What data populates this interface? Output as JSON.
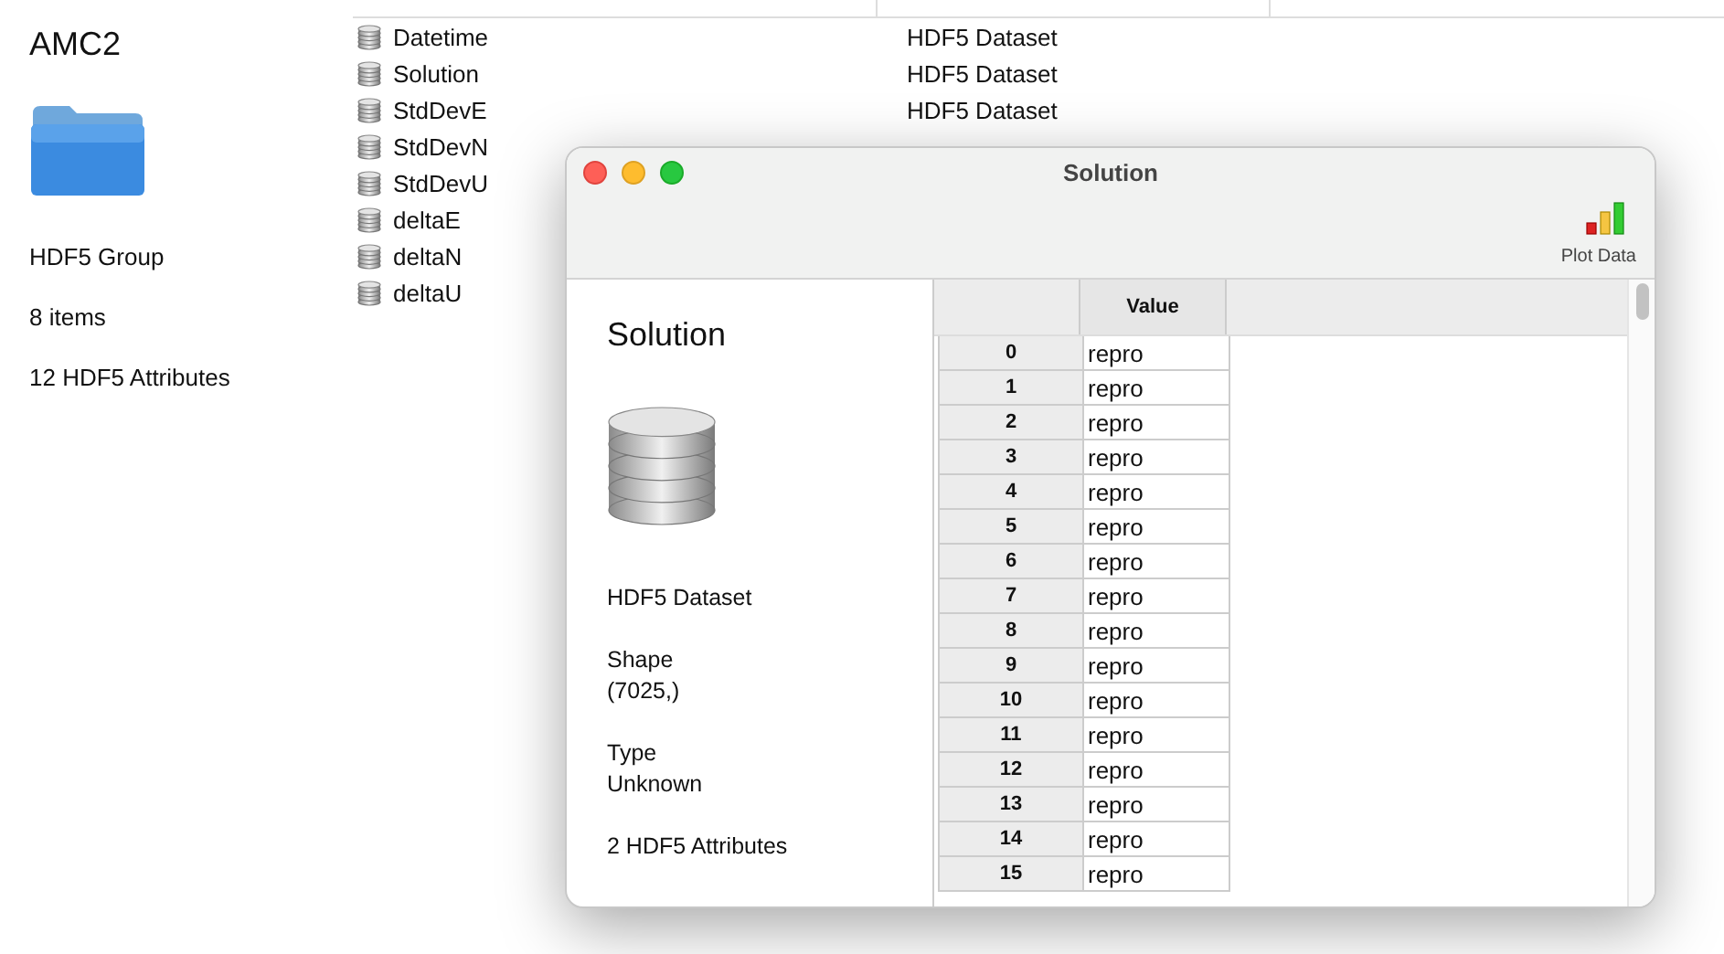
{
  "sidebar": {
    "title": "AMC2",
    "kind": "HDF5 Group",
    "count": "8 items",
    "attributes": "12 HDF5 Attributes"
  },
  "list": {
    "rows": [
      {
        "name": "Datetime",
        "kind": "HDF5 Dataset"
      },
      {
        "name": "Solution",
        "kind": "HDF5 Dataset"
      },
      {
        "name": "StdDevE",
        "kind": "HDF5 Dataset"
      },
      {
        "name": "StdDevN"
      },
      {
        "name": "StdDevU"
      },
      {
        "name": "deltaE"
      },
      {
        "name": "deltaN"
      },
      {
        "name": "deltaU"
      }
    ]
  },
  "window": {
    "title": "Solution",
    "toolbar": [
      {
        "label": "Plot Data"
      }
    ],
    "info": {
      "title": "Solution",
      "kind": "HDF5 Dataset",
      "shape_label": "Shape",
      "shape": "(7025,)",
      "type_label": "Type",
      "type": "Unknown",
      "attributes": "2 HDF5 Attributes"
    },
    "table": {
      "columns": [
        "Value"
      ],
      "rows": [
        [
          "0",
          "repro"
        ],
        [
          "1",
          "repro"
        ],
        [
          "2",
          "repro"
        ],
        [
          "3",
          "repro"
        ],
        [
          "4",
          "repro"
        ],
        [
          "5",
          "repro"
        ],
        [
          "6",
          "repro"
        ],
        [
          "7",
          "repro"
        ],
        [
          "8",
          "repro"
        ],
        [
          "9",
          "repro"
        ],
        [
          "10",
          "repro"
        ],
        [
          "11",
          "repro"
        ],
        [
          "12",
          "repro"
        ],
        [
          "13",
          "repro"
        ],
        [
          "14",
          "repro"
        ],
        [
          "15",
          "repro"
        ]
      ]
    }
  }
}
